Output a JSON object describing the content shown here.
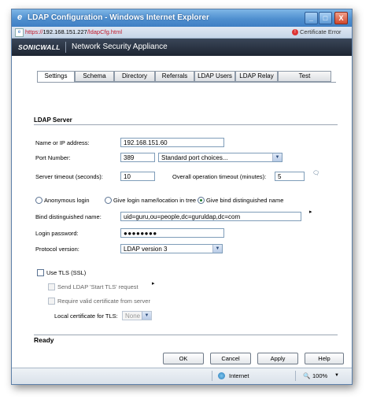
{
  "window": {
    "title": "LDAP Configuration - Windows Internet Explorer",
    "buttons": {
      "minimize": "_",
      "maximize": "□",
      "close": "X"
    }
  },
  "address": {
    "prefix": "https://",
    "host": "192.168.151.227",
    "path": "/ldapCfg.html",
    "cert_error": "Certificate Error"
  },
  "brand": {
    "logo": "SONICWALL",
    "product": "Network Security Appliance"
  },
  "tabs": [
    "Settings",
    "Schema",
    "Directory",
    "Referrals",
    "LDAP Users",
    "LDAP Relay",
    "Test"
  ],
  "server": {
    "section_title": "LDAP Server",
    "name_label": "Name or IP address:",
    "name_value": "192.168.151.60",
    "port_label": "Port Number:",
    "port_value": "389",
    "port_choices": "Standard port choices...",
    "timeout_label": "Server timeout (seconds):",
    "timeout_value": "10",
    "op_timeout_label": "Overall operation timeout (minutes):",
    "op_timeout_value": "5"
  },
  "login": {
    "options": [
      "Anonymous login",
      "Give login name/location in tree",
      "Give bind distinguished name"
    ],
    "selected": "Give bind distinguished name",
    "bind_label": "Bind distinguished name:",
    "bind_value": "uid=guru,ou=people,dc=guruldap,dc=com",
    "password_label": "Login password:",
    "password_value": "●●●●●●●●",
    "protocol_label": "Protocol version:",
    "protocol_value": "LDAP version 3"
  },
  "tls": {
    "use_tls": "Use TLS (SSL)",
    "start_tls": "Send LDAP 'Start TLS' request",
    "require_cert": "Require valid certificate from server",
    "local_cert_label": "Local certificate for TLS:",
    "local_cert_value": "None"
  },
  "status": {
    "text": "Ready"
  },
  "buttons": {
    "ok": "OK",
    "cancel": "Cancel",
    "apply": "Apply",
    "help": "Help"
  },
  "statusbar": {
    "zone": "Internet",
    "zoom": "100%"
  },
  "colors": {
    "title_bar": "#4f8fcf",
    "brand_bar": "#1d2532",
    "cert_error": "#d33333"
  }
}
